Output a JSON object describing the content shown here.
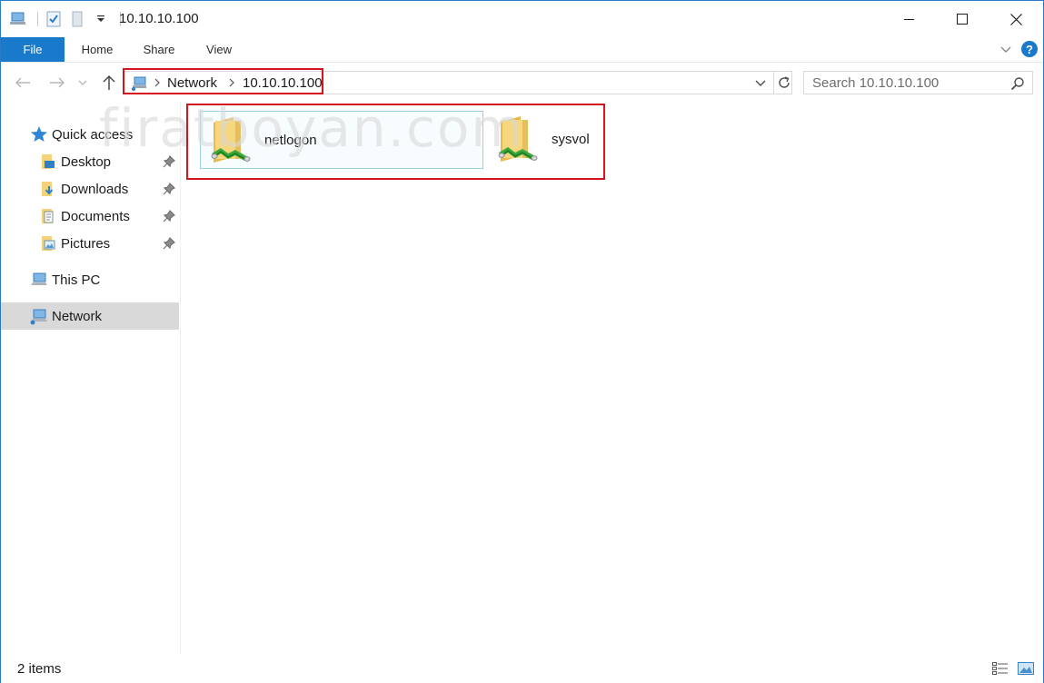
{
  "window": {
    "title": "10.10.10.100",
    "controls": {
      "minimize": "minimize-icon",
      "maximize": "maximize-icon",
      "close": "close-icon"
    }
  },
  "ribbon": {
    "tabs": [
      "File",
      "Home",
      "Share",
      "View"
    ],
    "help_label": "?"
  },
  "address_bar": {
    "breadcrumb": [
      "Network",
      "10.10.10.100"
    ]
  },
  "search": {
    "placeholder": "Search 10.10.10.100"
  },
  "sidebar": {
    "items": [
      {
        "label": "Quick access",
        "icon": "star-icon"
      },
      {
        "label": "Desktop",
        "icon": "desktop-folder-icon",
        "pinned": true
      },
      {
        "label": "Downloads",
        "icon": "downloads-folder-icon",
        "pinned": true
      },
      {
        "label": "Documents",
        "icon": "documents-folder-icon",
        "pinned": true
      },
      {
        "label": "Pictures",
        "icon": "pictures-folder-icon",
        "pinned": true
      },
      {
        "label": "This PC",
        "icon": "computer-icon"
      },
      {
        "label": "Network",
        "icon": "network-icon",
        "selected": true
      }
    ]
  },
  "content": {
    "watermark": "firatboyan.com",
    "items": [
      {
        "name": "netlogon",
        "icon": "shared-folder-icon",
        "selected": true
      },
      {
        "name": "sysvol",
        "icon": "shared-folder-icon",
        "selected": false
      }
    ]
  },
  "status": {
    "item_count": "2 items"
  },
  "colors": {
    "accent": "#1979ca",
    "highlight_box": "#d6131f",
    "selection_border": "#99d1ea",
    "nav_selected": "#d9d9d9"
  }
}
